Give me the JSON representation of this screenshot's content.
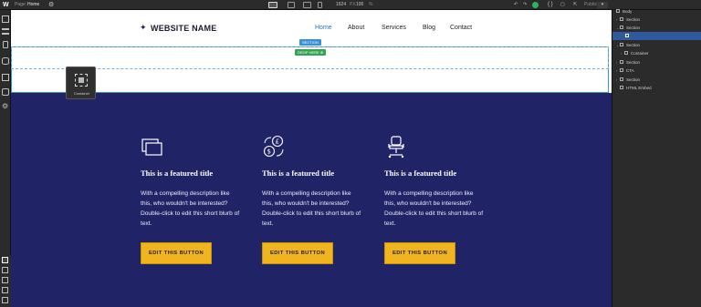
{
  "topbar": {
    "logo": "W",
    "page_label": "Page:",
    "page_name": "Home",
    "gear_glyph": "⚙",
    "canvas_width": "1624",
    "width_unit": "PX",
    "zoom": "100",
    "zoom_sep": "%",
    "undo_glyph": "↶",
    "redo_glyph": "↷",
    "code_glyph": "{ }",
    "cube_glyph": "▢",
    "share_glyph": "⇱",
    "publish_label": "Publish",
    "publish_chevron": "▾",
    "status_color": "#2fb35a"
  },
  "left_toolbar": {
    "icons": [
      "add-panel-icon",
      "navigator-icon",
      "pages-icon",
      "cms-icon",
      "assets-icon",
      "symbols-icon",
      "settings-icon"
    ],
    "settings_glyph": "⚙"
  },
  "header": {
    "brand_star": "✦",
    "brand_name": "WEBSITE NAME",
    "menu": [
      {
        "label": "Home",
        "active": true
      },
      {
        "label": "About",
        "active": false
      },
      {
        "label": "Services",
        "active": false
      },
      {
        "label": "Blog",
        "active": false
      },
      {
        "label": "Contact",
        "active": false
      }
    ]
  },
  "canvas_badges": {
    "section": "SECTION",
    "drop": "DROP HERE ⊕",
    "container_label": "Container"
  },
  "features": [
    {
      "icon": "folders-icon",
      "title": "This is a featured title",
      "description": "With a compelling description like this, who wouldn't be interested? Double-click to edit this short blurb of text.",
      "button": "EDIT THIS BUTTON"
    },
    {
      "icon": "currency-exchange-icon",
      "title": "This is a featured title",
      "description": "With a compelling description like this, who wouldn't be interested? Double-click to edit this short blurb of text.",
      "button": "EDIT THIS BUTTON"
    },
    {
      "icon": "office-chair-icon",
      "title": "This is a featured title",
      "description": "With a compelling description like this, who wouldn't be interested? Double-click to edit this short blurb of text.",
      "button": "EDIT THIS BUTTON"
    }
  ],
  "navigator": {
    "rows": [
      {
        "label": "Body",
        "caret": "",
        "selected": false
      },
      {
        "label": "Section",
        "caret": "›",
        "selected": false
      },
      {
        "label": "Section",
        "caret": "⌄",
        "selected": false
      },
      {
        "label": "",
        "caret": "",
        "selected": true
      },
      {
        "label": "Section",
        "caret": "⌄",
        "selected": false
      },
      {
        "label": "Container",
        "caret": "›",
        "selected": false
      },
      {
        "label": "Section",
        "caret": "›",
        "selected": false
      },
      {
        "label": "CTA",
        "caret": "›",
        "selected": false
      },
      {
        "label": "Section",
        "caret": "›",
        "selected": false
      },
      {
        "label": "HTML Embed",
        "caret": "",
        "selected": false
      }
    ]
  },
  "colors": {
    "features_bg": "#212367",
    "button_bg": "#f0b51e",
    "active_nav": "#2a70b9",
    "selection": "#3b8fd9"
  }
}
